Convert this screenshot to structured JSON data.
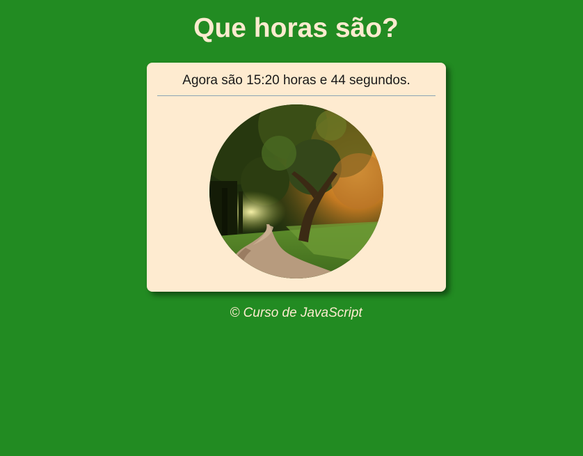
{
  "page": {
    "title": "Que horas são?"
  },
  "clock": {
    "message": "Agora são 15:20 horas e 44 segundos.",
    "image": "forest-path-afternoon"
  },
  "footer": {
    "text": "© Curso de JavaScript"
  },
  "colors": {
    "background": "#228b22",
    "card": "#feebd0",
    "title": "#fdebcf"
  }
}
